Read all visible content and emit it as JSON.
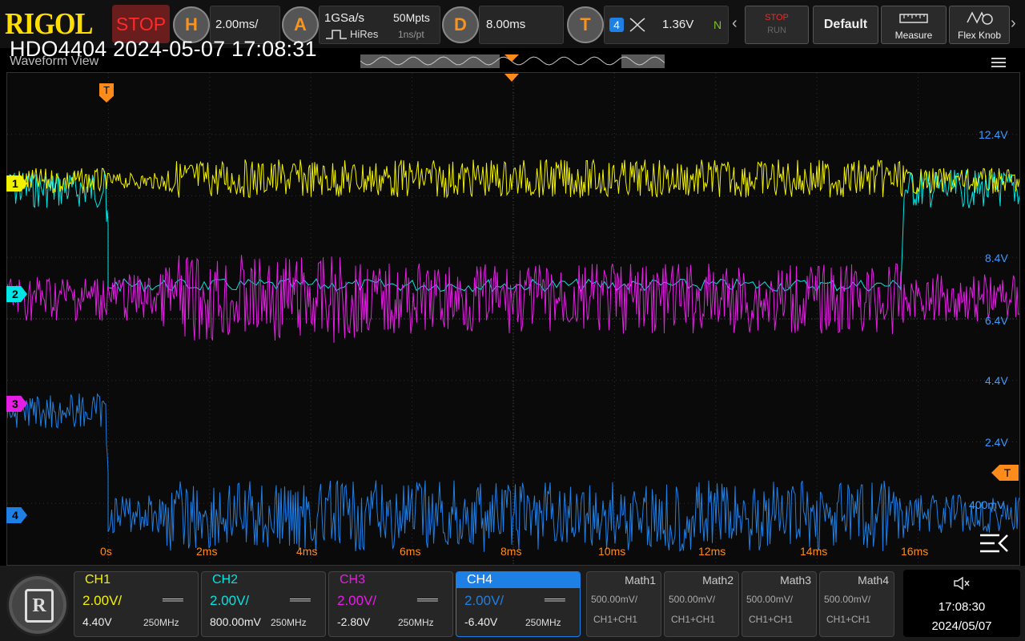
{
  "app": {
    "brand": "RIGOL",
    "run_state": "STOP",
    "model": "HDO4404",
    "screenshot_time": "2024-05-07 17:08:31",
    "view_title": "Waveform View"
  },
  "timebase": {
    "label": "H",
    "value": "2.00ms/"
  },
  "acquire": {
    "label": "A",
    "sample_rate": "1GSa/s",
    "mode": "HiRes",
    "memory": "50Mpts",
    "resolution": "1ns/pt"
  },
  "delay": {
    "label": "D",
    "value": "8.00ms"
  },
  "trigger": {
    "label": "T",
    "source": "4",
    "level": "1.36V",
    "mode": "N",
    "marker": "T"
  },
  "toolbar": {
    "stop_label": "STOP",
    "run_label": "RUN",
    "default_label": "Default",
    "measure_label": "Measure",
    "flexknob_label": "Flex Knob"
  },
  "colors": {
    "ch1": "#f2f200",
    "ch2": "#00e5e5",
    "ch3": "#e51ee5",
    "ch4": "#1e7fe5",
    "accent": "#ff8c1a"
  },
  "grid": {
    "time_labels": [
      "0s",
      "2ms",
      "4ms",
      "6ms",
      "8ms",
      "10ms",
      "12ms",
      "14ms",
      "16ms"
    ],
    "volt_labels": [
      "12.4V",
      "8.4V",
      "6.4V",
      "4.4V",
      "2.4V",
      "400mV"
    ]
  },
  "channels": [
    {
      "name": "CH1",
      "scale": "2.00V/",
      "offset": "4.40V",
      "bandwidth": "250MHz",
      "marker": "1"
    },
    {
      "name": "CH2",
      "scale": "2.00V/",
      "offset": "800.00mV",
      "bandwidth": "250MHz",
      "marker": "2"
    },
    {
      "name": "CH3",
      "scale": "2.00V/",
      "offset": "-2.80V",
      "bandwidth": "250MHz",
      "marker": "3"
    },
    {
      "name": "CH4",
      "scale": "2.00V/",
      "offset": "-6.40V",
      "bandwidth": "250MHz",
      "marker": "4"
    }
  ],
  "math": [
    {
      "name": "Math1",
      "scale": "500.00mV/",
      "expr": "CH1+CH1"
    },
    {
      "name": "Math2",
      "scale": "500.00mV/",
      "expr": "CH1+CH1"
    },
    {
      "name": "Math3",
      "scale": "500.00mV/",
      "expr": "CH1+CH1"
    },
    {
      "name": "Math4",
      "scale": "500.00mV/",
      "expr": "CH1+CH1"
    }
  ],
  "clock": {
    "time": "17:08:30",
    "date": "2024/05/07"
  }
}
